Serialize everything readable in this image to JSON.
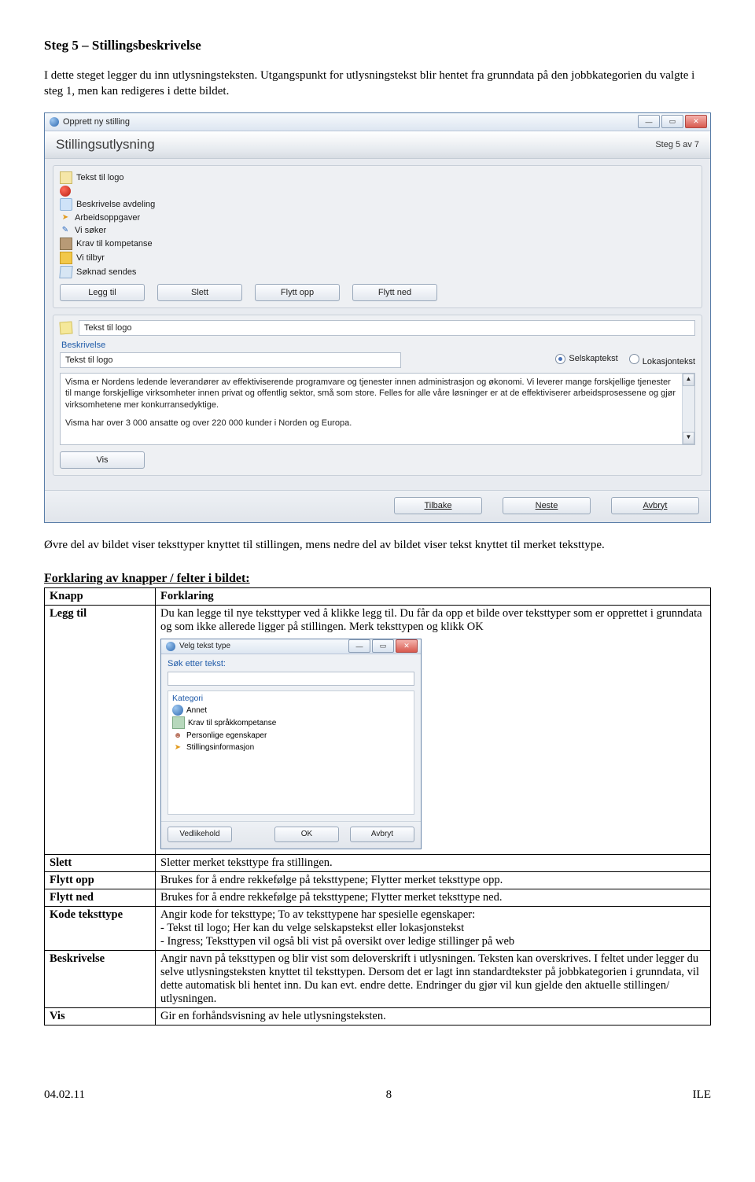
{
  "doc": {
    "title": "Steg 5 – Stillingsbeskrivelse",
    "para1": "I dette steget legger du inn utlysningsteksten. Utgangspunkt for utlysningstekst blir hentet fra grunndata på den jobbkategorien du valgte i steg 1, men kan redigeres i dette bildet.",
    "para2": "Øvre del av bildet viser teksttyper knyttet til stillingen, mens nedre del av bildet viser tekst knyttet til merket teksttype.",
    "section_title": "Forklaring av knapper / felter i bildet:"
  },
  "window": {
    "title": "Opprett ny stilling",
    "header_title": "Stillingsutlysning",
    "header_step": "Steg 5 av 7",
    "items": [
      "Tekst til logo",
      "",
      "Beskrivelse avdeling",
      "Arbeidsoppgaver",
      "Vi søker",
      "Krav til kompetanse",
      "Vi tilbyr",
      "Søknad sendes"
    ],
    "buttons": {
      "add": "Legg til",
      "del": "Slett",
      "up": "Flytt opp",
      "down": "Flytt ned",
      "vis": "Vis",
      "back": "Tilbake",
      "next": "Neste",
      "cancel": "Avbryt"
    },
    "code_value": "Tekst til logo",
    "desc_label": "Beskrivelse",
    "desc_value": "Tekst til logo",
    "radio1": "Selskaptekst",
    "radio2": "Lokasjontekst",
    "desc_text1": "Visma er Nordens ledende leverandører av effektiviserende programvare og tjenester innen administrasjon og økonomi. Vi leverer mange forskjellige tjenester til mange forskjellige virksomheter innen privat og offentlig sektor, små som store. Felles for alle våre løsninger er at de effektiviserer arbeidsprosessene og gjør virksomhetene mer konkurransedyktige.",
    "desc_text2": "Visma har over 3 000 ansatte og over 220 000 kunder i Norden og Europa."
  },
  "table": {
    "headers": {
      "col1": "Knapp",
      "col2": "Forklaring"
    },
    "rows": {
      "legg_til": {
        "label": "Legg til",
        "text": "Du kan legge til nye teksttyper ved å klikke legg til. Du får da opp et bilde over teksttyper som er opprettet i grunndata og som ikke allerede ligger på stillingen. Merk teksttypen og klikk OK"
      },
      "slett": {
        "label": "Slett",
        "text": "Sletter merket teksttype fra stillingen."
      },
      "flytt_opp": {
        "label": "Flytt opp",
        "text": "Brukes for å endre rekkefølge på teksttypene; Flytter merket teksttype opp."
      },
      "flytt_ned": {
        "label": "Flytt ned",
        "text": "Brukes for å endre rekkefølge på teksttypene; Flytter merket teksttype ned."
      },
      "kode": {
        "label": "Kode teksttype",
        "text": "Angir kode for teksttype; To av teksttypene har spesielle egenskaper:\n- Tekst til logo; Her kan du velge selskapstekst eller lokasjonstekst\n- Ingress; Teksttypen vil også bli vist på oversikt over ledige stillinger på web"
      },
      "beskrivelse": {
        "label": "Beskrivelse",
        "text": "Angir navn på teksttypen og blir vist som deloverskrift i utlysningen. Teksten kan overskrives. I feltet under legger du selve utlysningsteksten knyttet til teksttypen.  Dersom det er lagt inn standardtekster på jobbkategorien i grunndata, vil dette automatisk bli hentet inn. Du kan evt. endre dette. Endringer du gjør vil kun gjelde den aktuelle stillingen/ utlysningen."
      },
      "vis": {
        "label": "Vis",
        "text": "Gir en forhåndsvisning av hele utlysningsteksten."
      }
    }
  },
  "popup": {
    "title": "Velg tekst type",
    "search_label": "Søk etter tekst:",
    "category_label": "Kategori",
    "items": [
      "Annet",
      "Krav til språkkompetanse",
      "Personlige egenskaper",
      "Stillingsinformasjon"
    ],
    "buttons": {
      "maint": "Vedlikehold",
      "ok": "OK",
      "cancel": "Avbryt"
    }
  },
  "footer": {
    "left": "04.02.11",
    "center": "8",
    "right": "ILE"
  }
}
